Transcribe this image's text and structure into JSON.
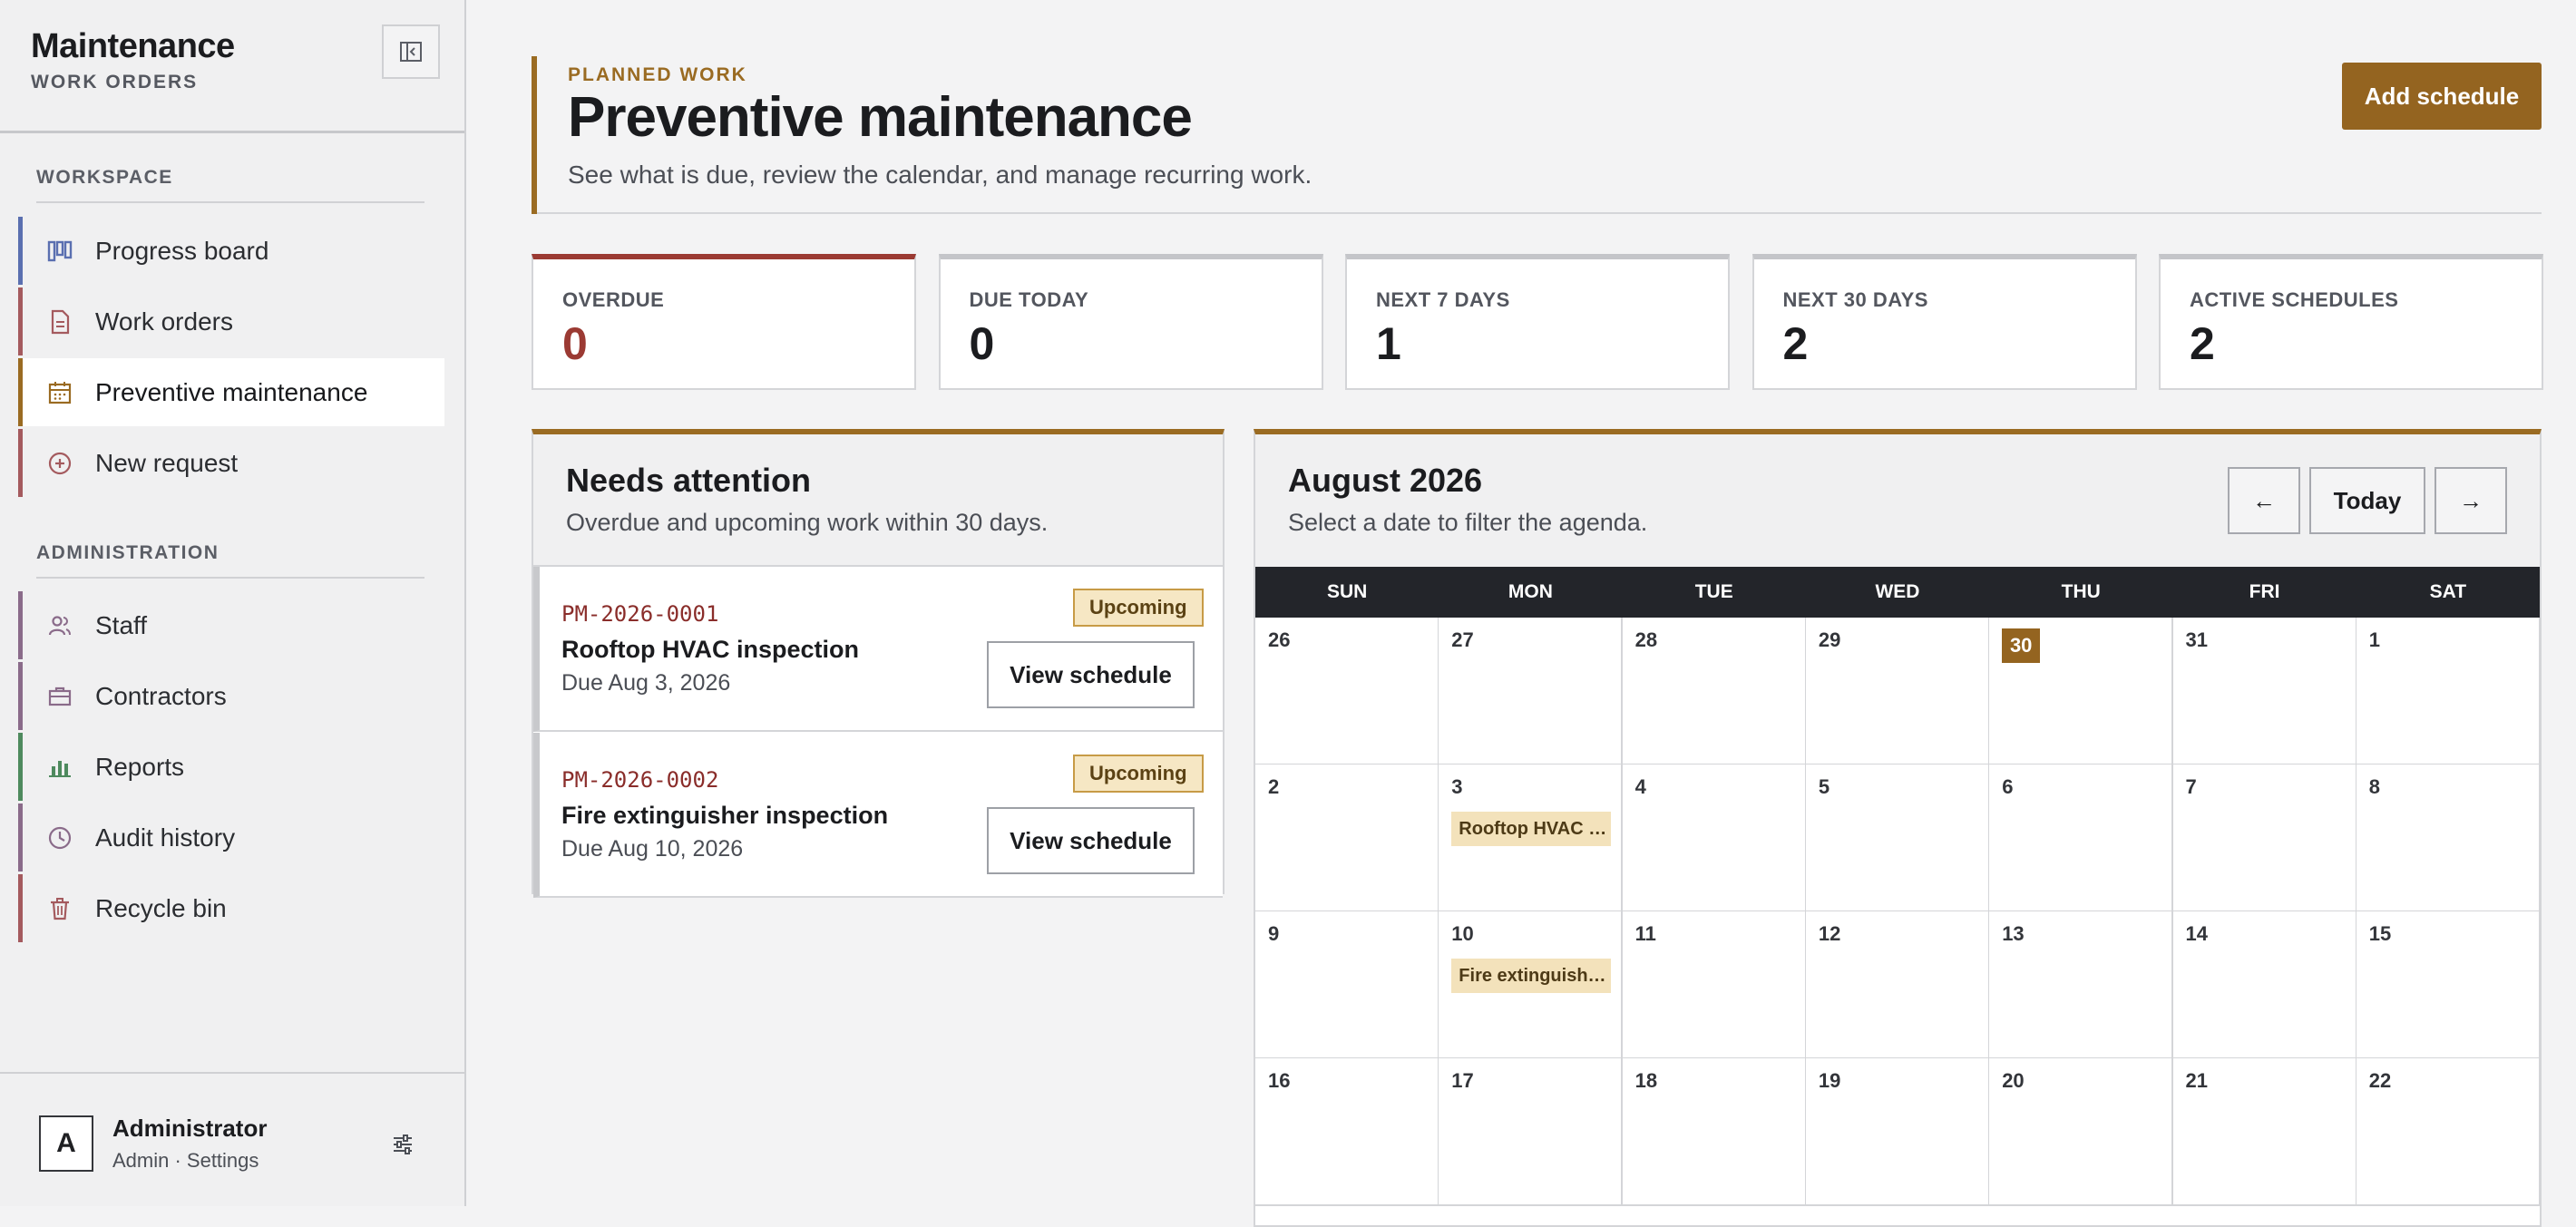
{
  "app": {
    "title": "Maintenance",
    "subtitle": "WORK ORDERS"
  },
  "sidebar": {
    "workspace_label": "WORKSPACE",
    "admin_label": "ADMINISTRATION",
    "workspace_items": [
      {
        "label": "Progress board",
        "icon": "board-icon",
        "color": "#5a6fb0"
      },
      {
        "label": "Work orders",
        "icon": "document-icon",
        "color": "#a45a5e"
      },
      {
        "label": "Preventive maintenance",
        "icon": "calendar-icon",
        "color": "#9a6b22",
        "active": true
      },
      {
        "label": "New request",
        "icon": "plus-circle-icon",
        "color": "#a45a5e"
      }
    ],
    "admin_items": [
      {
        "label": "Staff",
        "icon": "users-icon",
        "color": "#8a6b8a"
      },
      {
        "label": "Contractors",
        "icon": "briefcase-icon",
        "color": "#8a6b8a"
      },
      {
        "label": "Reports",
        "icon": "bar-chart-icon",
        "color": "#4e8a5e"
      },
      {
        "label": "Audit history",
        "icon": "clock-icon",
        "color": "#8a6b8a"
      },
      {
        "label": "Recycle bin",
        "icon": "trash-icon",
        "color": "#a45a5e"
      }
    ],
    "user": {
      "initial": "A",
      "name": "Administrator",
      "role": "Admin · Settings"
    }
  },
  "header": {
    "eyebrow": "PLANNED WORK",
    "title": "Preventive maintenance",
    "description": "See what is due, review the calendar, and manage recurring work.",
    "add_button": "Add schedule"
  },
  "stats": [
    {
      "label": "OVERDUE",
      "value": "0",
      "tone": "red"
    },
    {
      "label": "DUE TODAY",
      "value": "0",
      "tone": "neutral"
    },
    {
      "label": "NEXT 7 DAYS",
      "value": "1",
      "tone": "neutral"
    },
    {
      "label": "NEXT 30 DAYS",
      "value": "2",
      "tone": "neutral"
    },
    {
      "label": "ACTIVE SCHEDULES",
      "value": "2",
      "tone": "neutral"
    }
  ],
  "attention": {
    "title": "Needs attention",
    "subtitle": "Overdue and upcoming work within 30 days.",
    "items": [
      {
        "id": "PM-2026-0001",
        "name": "Rooftop HVAC inspection",
        "due": "Due Aug 3, 2026",
        "status": "Upcoming",
        "action": "View schedule"
      },
      {
        "id": "PM-2026-0002",
        "name": "Fire extinguisher inspection",
        "due": "Due Aug 10, 2026",
        "status": "Upcoming",
        "action": "View schedule"
      }
    ]
  },
  "calendar": {
    "title": "August 2026",
    "subtitle": "Select a date to filter the agenda.",
    "prev_label": "←",
    "today_label": "Today",
    "next_label": "→",
    "weekdays": [
      "SUN",
      "MON",
      "TUE",
      "WED",
      "THU",
      "FRI",
      "SAT"
    ],
    "weeks": [
      [
        {
          "day": "26"
        },
        {
          "day": "27"
        },
        {
          "day": "28"
        },
        {
          "day": "29"
        },
        {
          "day": "30",
          "today": true
        },
        {
          "day": "31"
        },
        {
          "day": "1"
        }
      ],
      [
        {
          "day": "2"
        },
        {
          "day": "3",
          "event": "Rooftop HVAC inspection"
        },
        {
          "day": "4"
        },
        {
          "day": "5"
        },
        {
          "day": "6"
        },
        {
          "day": "7"
        },
        {
          "day": "8"
        }
      ],
      [
        {
          "day": "9"
        },
        {
          "day": "10",
          "event": "Fire extinguisher inspection"
        },
        {
          "day": "11"
        },
        {
          "day": "12"
        },
        {
          "day": "13"
        },
        {
          "day": "14"
        },
        {
          "day": "15"
        }
      ],
      [
        {
          "day": "16"
        },
        {
          "day": "17"
        },
        {
          "day": "18"
        },
        {
          "day": "19"
        },
        {
          "day": "20"
        },
        {
          "day": "21"
        },
        {
          "day": "22"
        }
      ]
    ]
  },
  "colors": {
    "accent": "#9a6b22",
    "danger": "#9b3a33",
    "badge_bg": "#f6e7c4",
    "event_bg": "#f3e2bb"
  }
}
